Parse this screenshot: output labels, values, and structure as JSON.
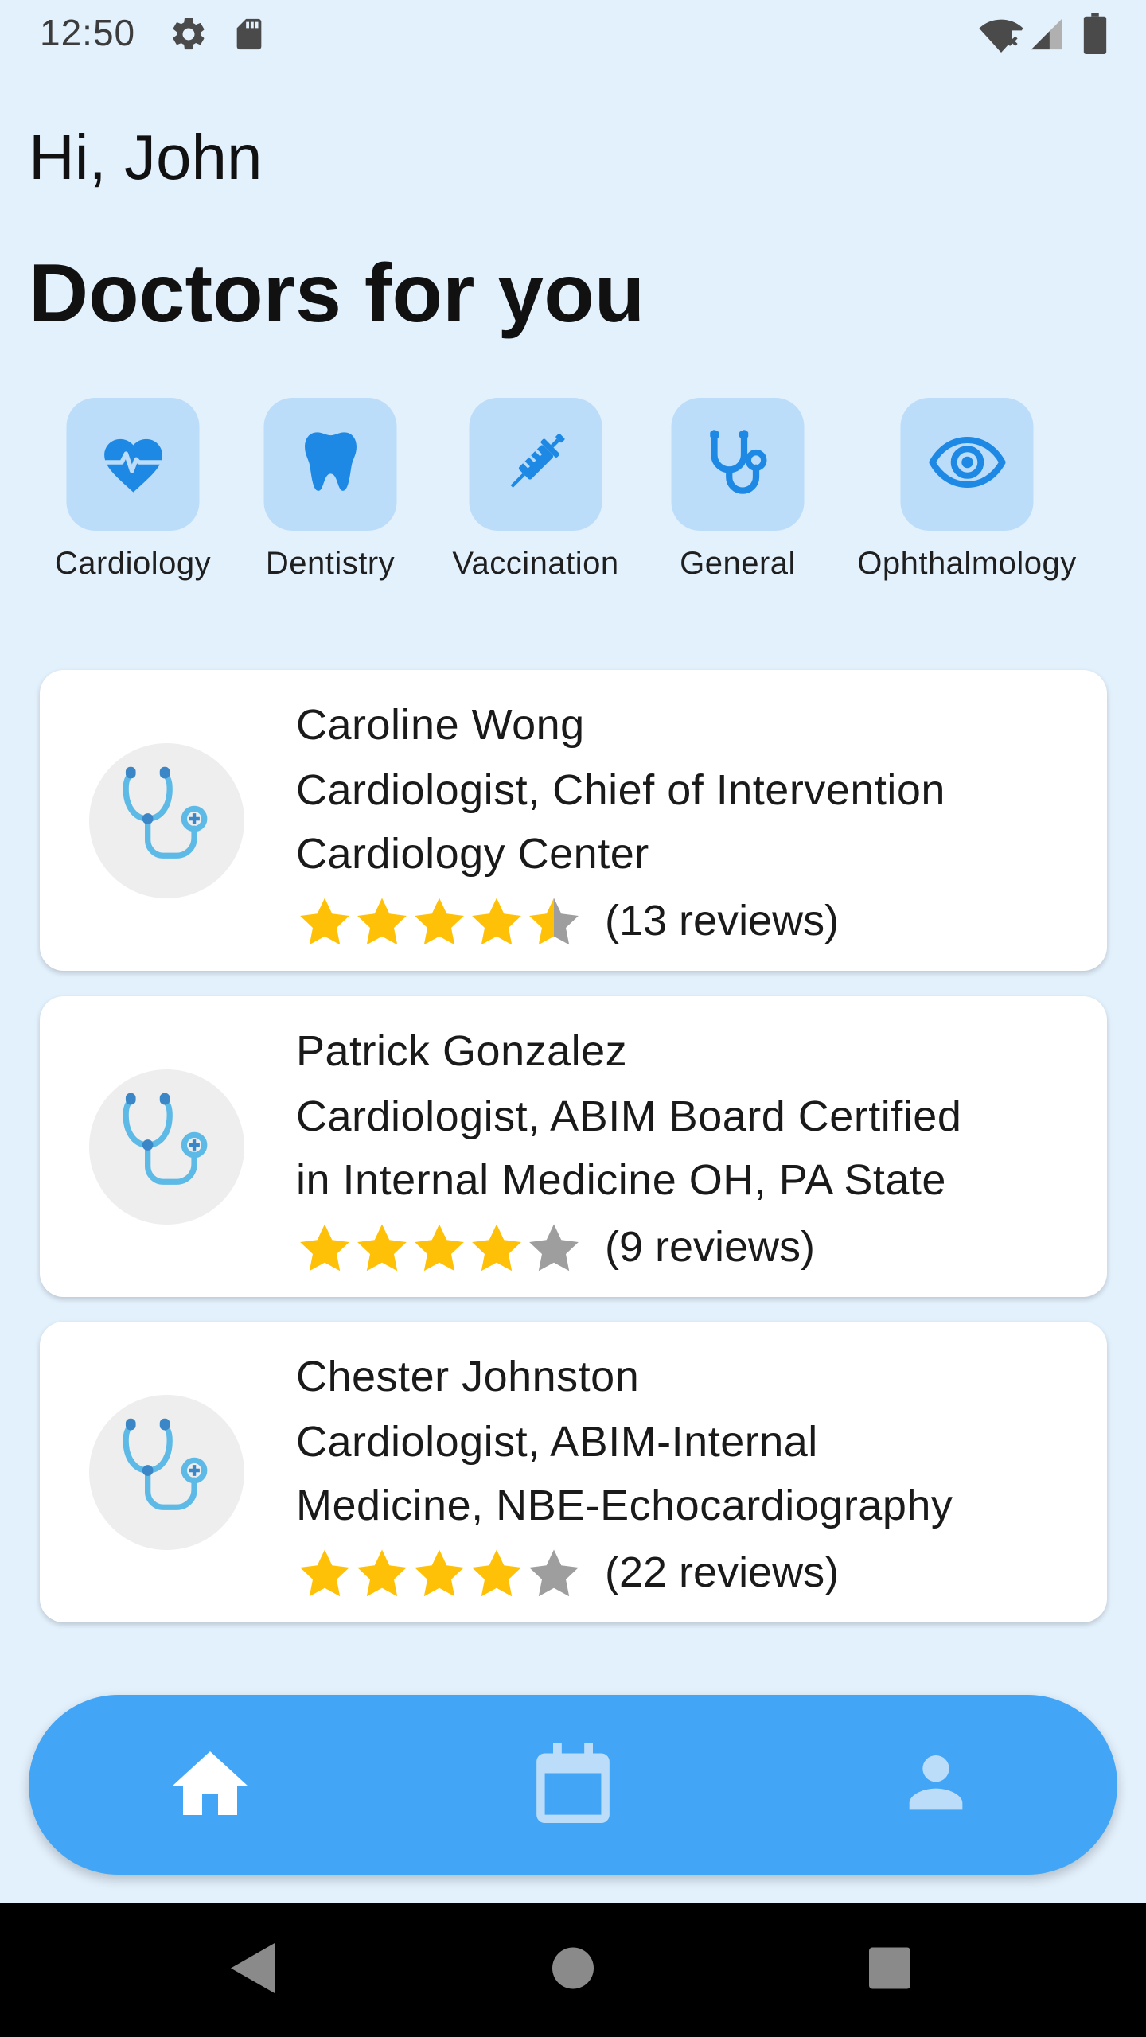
{
  "status_bar": {
    "time": "12:50",
    "icons": [
      "settings-icon",
      "sd-card-icon",
      "wifi-off-icon",
      "signal-icon",
      "battery-icon"
    ]
  },
  "greeting": "Hi, John",
  "title": "Doctors for you",
  "categories": [
    {
      "label": "Cardiology",
      "icon": "heart-pulse-icon"
    },
    {
      "label": "Dentistry",
      "icon": "tooth-icon"
    },
    {
      "label": "Vaccination",
      "icon": "syringe-icon"
    },
    {
      "label": "General",
      "icon": "stethoscope-icon"
    },
    {
      "label": "Ophthalmology",
      "icon": "eye-icon"
    }
  ],
  "doctors": [
    {
      "name": "Caroline Wong",
      "line1": "Cardiologist, Chief of Intervention",
      "line2": "Cardiology Center",
      "rating": 4.5,
      "reviews": "(13 reviews)"
    },
    {
      "name": "Patrick Gonzalez",
      "line1": "Cardiologist, ABIM Board Certified",
      "line2": "in Internal Medicine OH, PA State",
      "rating": 4,
      "reviews": "(9 reviews)"
    },
    {
      "name": "Chester Johnston",
      "line1": "Cardiologist, ABIM-Internal",
      "line2": "Medicine, NBE-Echocardiography",
      "rating": 4,
      "reviews": "(22 reviews)"
    }
  ],
  "bottom_nav": {
    "items": [
      "home-icon",
      "calendar-icon",
      "person-icon"
    ],
    "active": "home-icon"
  },
  "colors": {
    "background": "#E3F1FD",
    "accent": "#42A5F5",
    "icon_blue": "#1E88E5",
    "tile_bg": "#BBDDF9",
    "star_filled": "#FFC107",
    "star_empty": "#9E9E9E"
  }
}
